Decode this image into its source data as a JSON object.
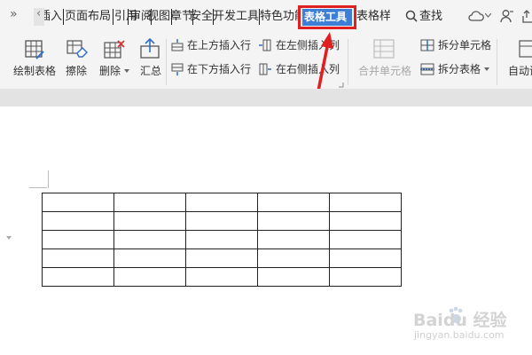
{
  "tabs": {
    "overflow_label": "»",
    "scroll_left_label": "‹",
    "insert_partial": "插入",
    "page_layout": "页面布局",
    "references": "引用",
    "review": "审阅",
    "view": "视图",
    "section": "章节",
    "security": "安全",
    "developer": "开发工具",
    "special": "特色功能",
    "table_tools": "表格工具",
    "table_style": "表格样式",
    "search_label": "查找"
  },
  "ribbon": {
    "draw_table": "绘制表格",
    "erase": "擦除",
    "delete": "删除",
    "summary": "汇总",
    "insert_above": "在上方插入行",
    "insert_below": "在下方插入行",
    "insert_left": "在左侧插入列",
    "insert_right": "在右侧插入列",
    "merge_cells": "合并单元格",
    "split_cells": "拆分单元格",
    "split_table": "拆分表格",
    "autofit": "自动调"
  },
  "document": {
    "table_rows": 5,
    "table_cols": 5
  },
  "watermark": {
    "brand": "Baidu 经验",
    "url": "jingyan.baidu.com"
  },
  "colors": {
    "highlight": "#e02020",
    "active_tab": "#3d7fd6"
  }
}
